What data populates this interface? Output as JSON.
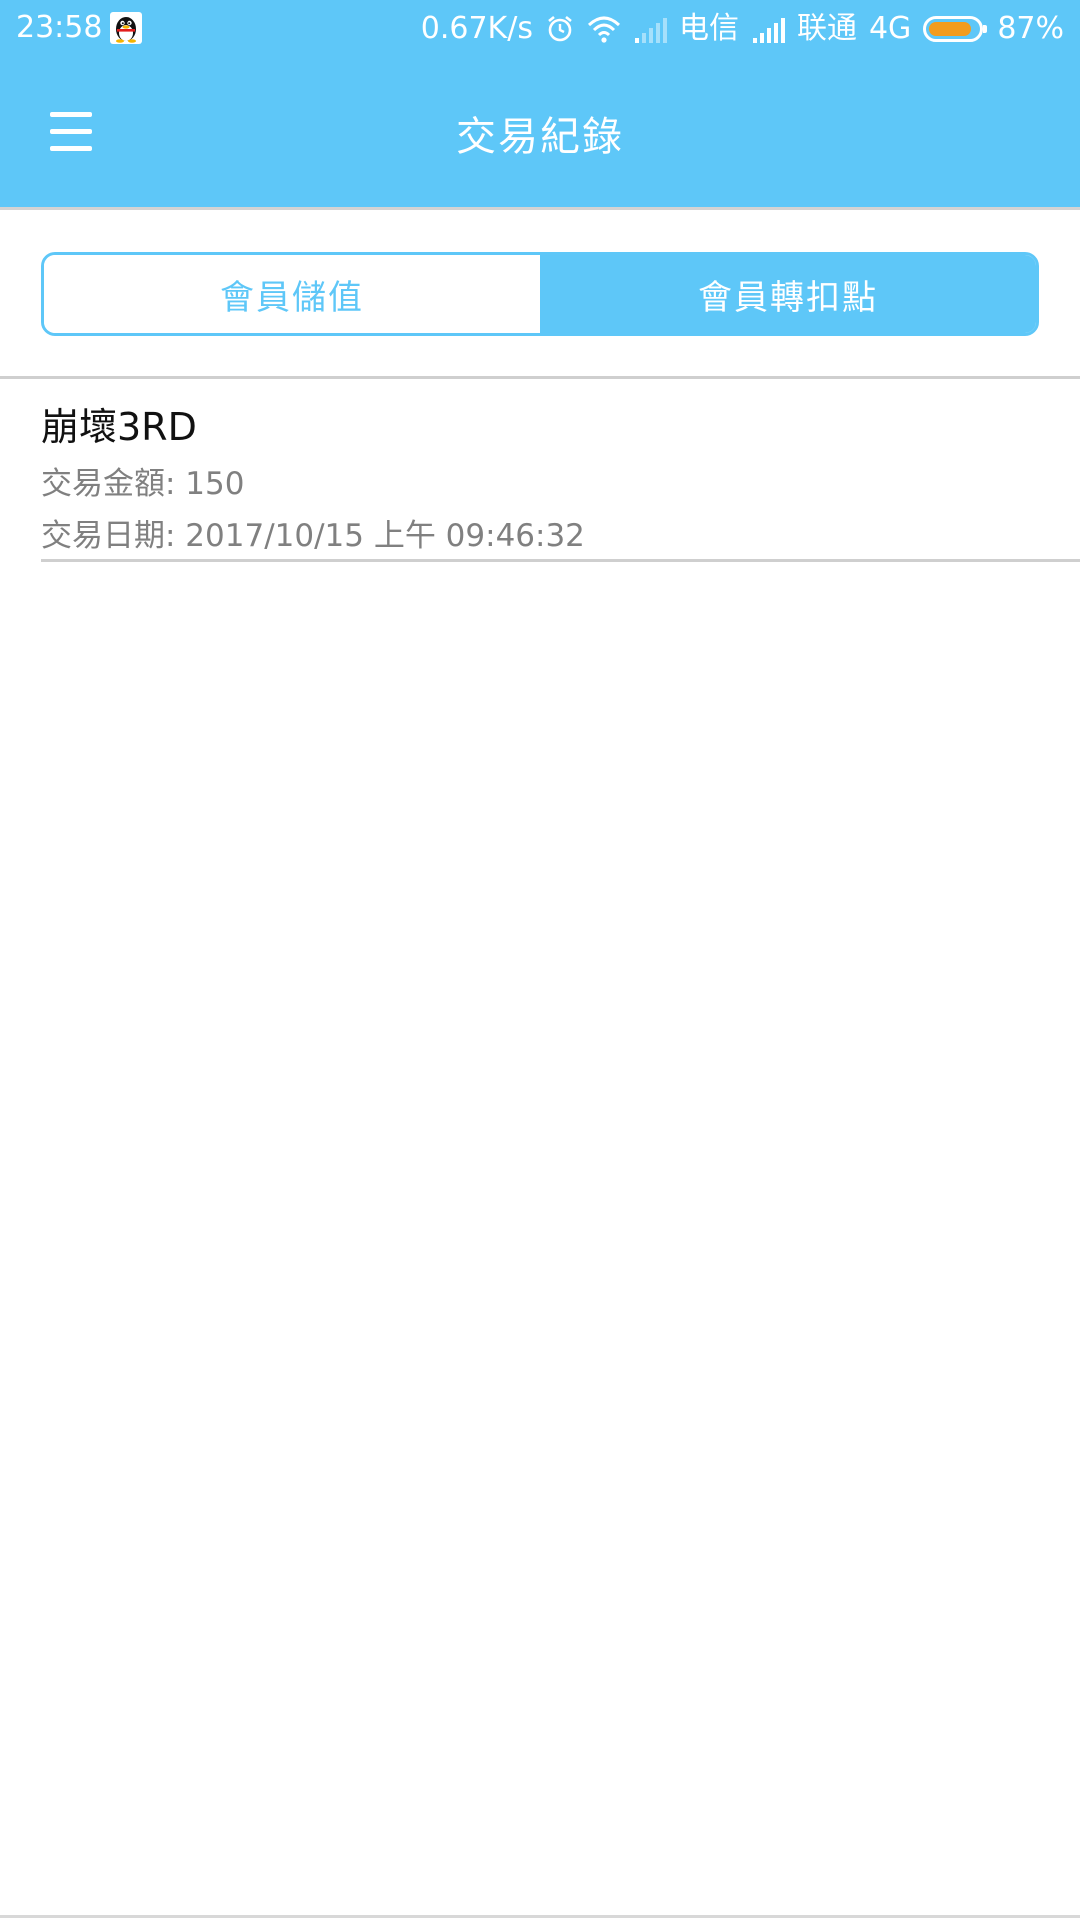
{
  "status_bar": {
    "time": "23:58",
    "net_speed": "0.67K/s",
    "carrier1": "电信",
    "carrier2": "联通",
    "network": "4G",
    "battery": "87%",
    "battery_level": 0.87,
    "battery_color": "#f39c1e",
    "icons": [
      "qq-icon",
      "alarm-icon",
      "wifi-icon",
      "signal-icon",
      "battery-icon"
    ]
  },
  "app_bar": {
    "title": "交易紀錄",
    "menu_icon": "hamburger-menu-icon",
    "background": "#5ec7f8"
  },
  "tabs": [
    {
      "label": "會員儲值",
      "active": false
    },
    {
      "label": "會員轉扣點",
      "active": true
    }
  ],
  "records": [
    {
      "name": "崩壞3RD",
      "amount": "交易金額: 150",
      "date": "交易日期: 2017/10/15 上午 09:46:32"
    }
  ]
}
